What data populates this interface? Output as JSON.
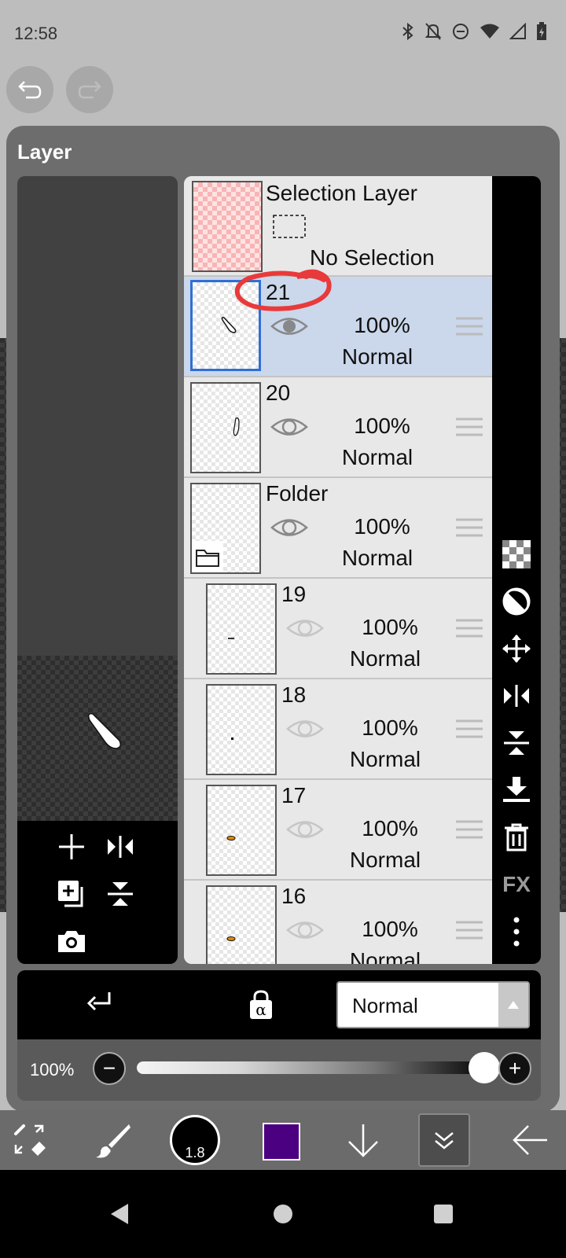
{
  "status_bar": {
    "time": "12:58"
  },
  "panel": {
    "title": "Layer"
  },
  "selection_layer": {
    "title": "Selection Layer",
    "status": "No Selection"
  },
  "layers": [
    {
      "name": "21",
      "opacity": "100%",
      "blend": "Normal",
      "selected": true,
      "visible": true
    },
    {
      "name": "20",
      "opacity": "100%",
      "blend": "Normal",
      "selected": false,
      "visible": true
    },
    {
      "name": "Folder",
      "opacity": "100%",
      "blend": "Normal",
      "selected": false,
      "visible": true,
      "is_folder": true
    },
    {
      "name": "19",
      "opacity": "100%",
      "blend": "Normal",
      "selected": false,
      "visible": false
    },
    {
      "name": "18",
      "opacity": "100%",
      "blend": "Normal",
      "selected": false,
      "visible": false
    },
    {
      "name": "17",
      "opacity": "100%",
      "blend": "Normal",
      "selected": false,
      "visible": false
    },
    {
      "name": "16",
      "opacity": "100%",
      "blend": "Normal",
      "selected": false,
      "visible": false
    }
  ],
  "side_tools": {
    "fx_label": "FX"
  },
  "blend_mode": {
    "value": "Normal"
  },
  "opacity": {
    "label": "100%",
    "minus": "−",
    "plus": "+",
    "level": 1.0
  },
  "toolbar": {
    "brush_size": "1.8",
    "color": "#4b0082"
  },
  "colors": {
    "panel": "#6d6d6d",
    "selected_row": "#cbd7eb",
    "annotation": "#e83a3a",
    "thumb_selected_border": "#2f6fd6"
  }
}
